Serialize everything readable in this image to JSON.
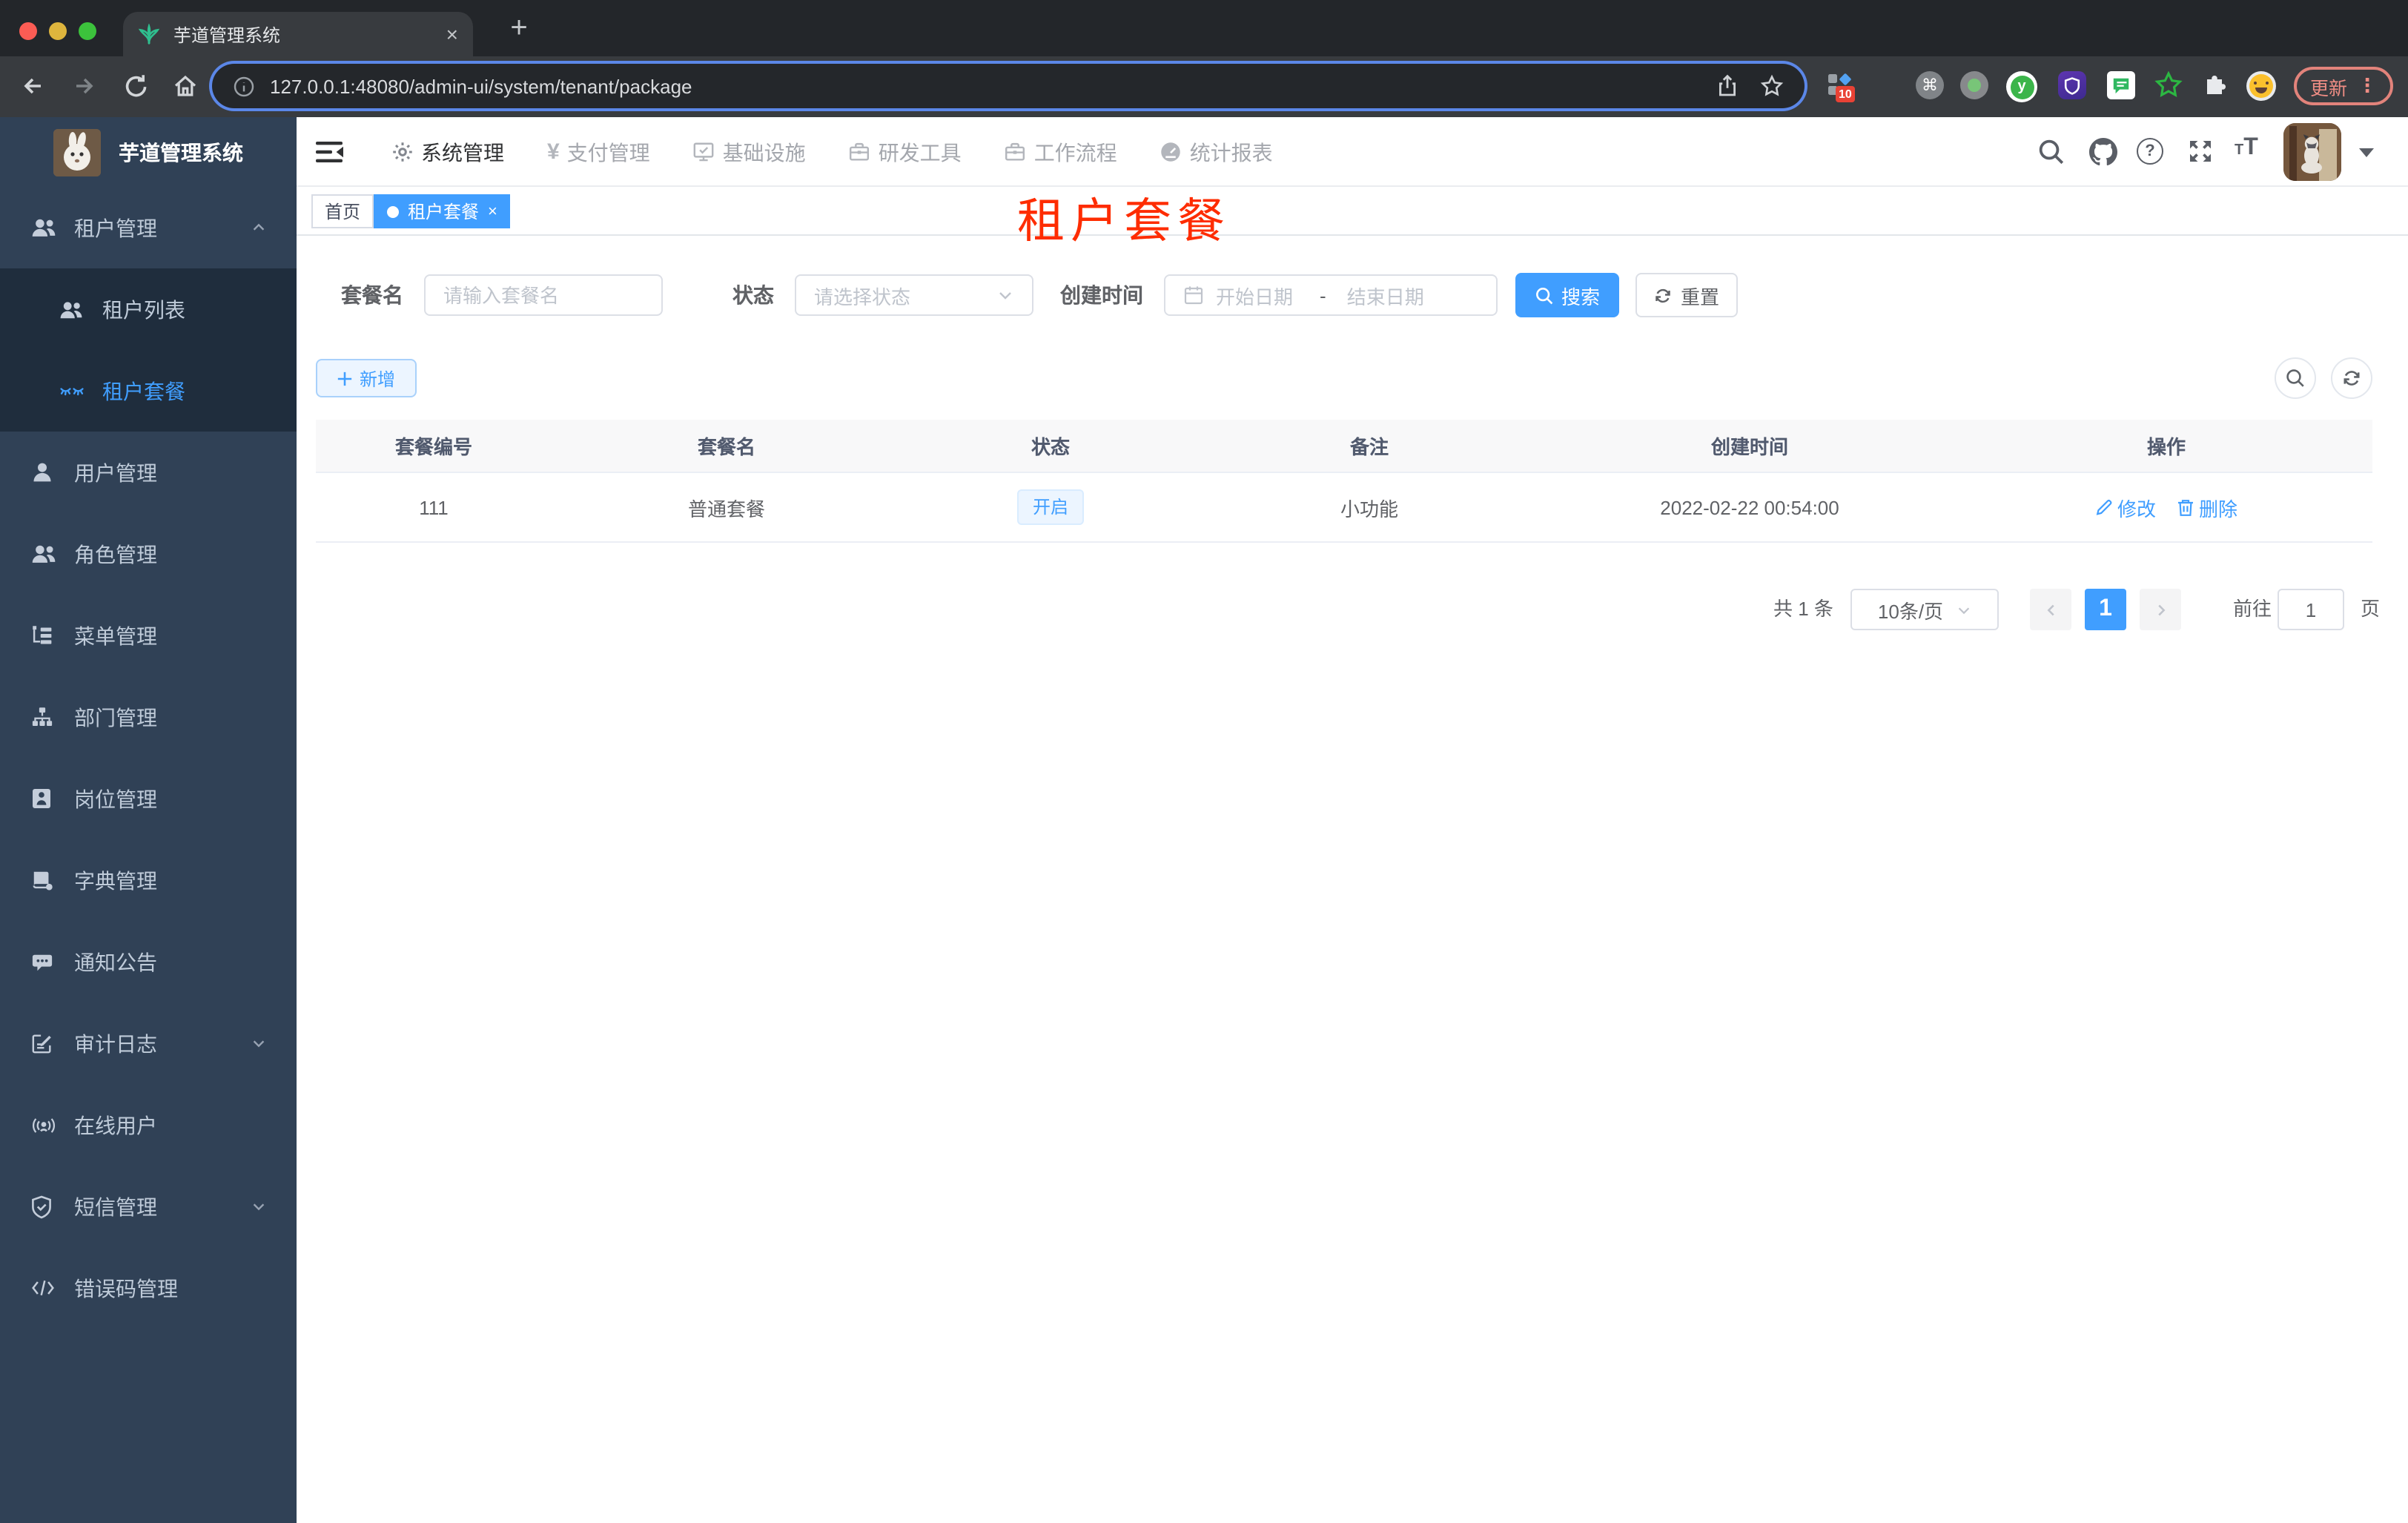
{
  "glyphs": {
    "close": "×",
    "plus": "+",
    "dots": "⋮",
    "cmd": "⌘",
    "question": "?",
    "font_size_small": "T",
    "font_size_big": "T"
  },
  "browser": {
    "tab_title": "芋道管理系统",
    "url": "127.0.0.1:48080/admin-ui/system/tenant/package",
    "extension_badge": "10",
    "update_label": "更新"
  },
  "logo": {
    "title": "芋道管理系统"
  },
  "nav": {
    "menus": [
      {
        "label": "系统管理"
      },
      {
        "label": "支付管理"
      },
      {
        "label": "基础设施"
      },
      {
        "label": "研发工具"
      },
      {
        "label": "工作流程"
      },
      {
        "label": "统计报表"
      }
    ]
  },
  "sidebar": {
    "items": [
      {
        "label": "租户管理"
      },
      {
        "label": "租户列表"
      },
      {
        "label": "租户套餐"
      },
      {
        "label": "用户管理"
      },
      {
        "label": "角色管理"
      },
      {
        "label": "菜单管理"
      },
      {
        "label": "部门管理"
      },
      {
        "label": "岗位管理"
      },
      {
        "label": "字典管理"
      },
      {
        "label": "通知公告"
      },
      {
        "label": "审计日志"
      },
      {
        "label": "在线用户"
      },
      {
        "label": "短信管理"
      },
      {
        "label": "错误码管理"
      }
    ]
  },
  "tags": {
    "home": "首页",
    "active": "租户套餐"
  },
  "overlay": {
    "title": "租户套餐"
  },
  "filter": {
    "name_label": "套餐名",
    "name_placeholder": "请输入套餐名",
    "status_label": "状态",
    "status_placeholder": "请选择状态",
    "date_label": "创建时间",
    "date_start": "开始日期",
    "date_separator": "-",
    "date_end": "结束日期",
    "search_label": "搜索",
    "reset_label": "重置"
  },
  "toolbar": {
    "add_label": "新增"
  },
  "table": {
    "columns": [
      "套餐编号",
      "套餐名",
      "状态",
      "备注",
      "创建时间",
      "操作"
    ],
    "row": {
      "id": "111",
      "name": "普通套餐",
      "status": "开启",
      "remark": "小功能",
      "created_at": "2022-02-22 00:54:00",
      "edit_label": "修改",
      "delete_label": "删除"
    }
  },
  "pagination": {
    "total": "共 1 条",
    "page_size": "10条/页",
    "current_page": "1",
    "goto_label": "前往",
    "goto_value": "1",
    "unit_label": "页"
  },
  "colors": {
    "primary": "#409EFF",
    "sidebar_bg": "#304156",
    "submenu_bg": "#1F2D3D",
    "title_red": "#FE2C00",
    "tag_active_bg": "#409EFF"
  }
}
